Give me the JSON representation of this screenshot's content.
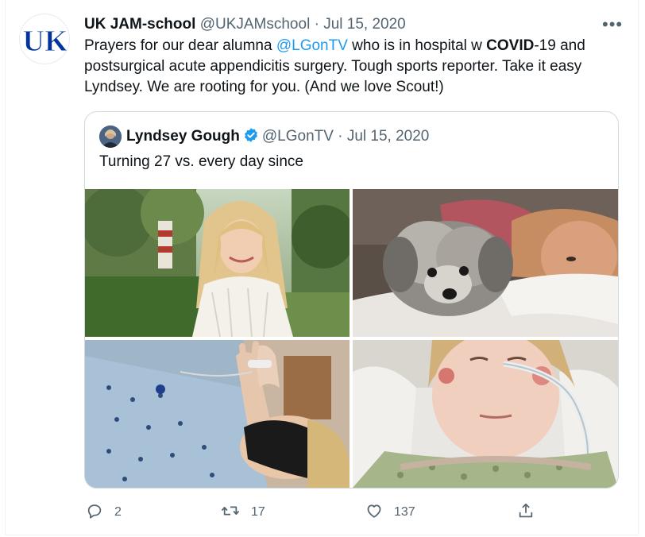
{
  "tweet": {
    "author_name": "UK JAM-school",
    "author_handle": "@UKJAMschool",
    "separator": "·",
    "date": "Jul 15, 2020",
    "more_label": "•••",
    "avatar_logo_text": "UK",
    "text_parts": {
      "p1": "Prayers for our dear alumna ",
      "mention": "@LGonTV",
      "p2": " who is in hospital w ",
      "bold": "COVID",
      "p3": "-19 and postsurgical acute appendicitis surgery. Tough sports reporter. Take it easy Lyndsey. We are rooting for you. (And we love Scout!)"
    }
  },
  "quote": {
    "author_name": "Lyndsey Gough",
    "author_handle": "@LGonTV",
    "separator": "·",
    "date": "Jul 15, 2020",
    "text": "Turning 27 vs. every day since",
    "photos": [
      {
        "id": "photo-birthday",
        "subject": "woman smiling outdoors in white lace top"
      },
      {
        "id": "photo-dog",
        "subject": "woman lying in bed with small gray dog"
      },
      {
        "id": "photo-hospital-mask",
        "subject": "patient in hospital gown with face mask"
      },
      {
        "id": "photo-hospital-tube",
        "subject": "patient in hospital bed with nasal tube"
      }
    ]
  },
  "actions": {
    "reply_count": "2",
    "retweet_count": "17",
    "like_count": "137",
    "icons": [
      "reply-icon",
      "retweet-icon",
      "like-icon",
      "share-icon"
    ]
  },
  "colors": {
    "accent": "#1d9bf0",
    "muted": "#536471",
    "uk_blue": "#0033a0",
    "border": "#cfd9de"
  }
}
